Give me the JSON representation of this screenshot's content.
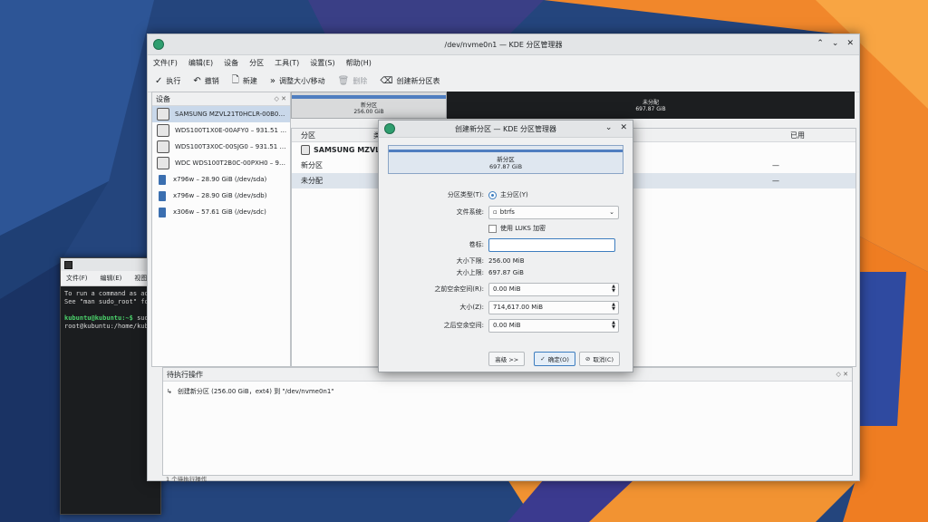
{
  "window": {
    "title": "/dev/nvme0n1 — KDE 分区管理器",
    "menu": [
      "文件(F)",
      "编辑(E)",
      "设备",
      "分区",
      "工具(T)",
      "设置(S)",
      "帮助(H)"
    ],
    "toolbar": {
      "apply": "执行",
      "undo": "撤销",
      "new": "新建",
      "resize": "调整大小/移动",
      "delete": "删除",
      "new_table": "创建新分区表"
    }
  },
  "devices": {
    "header": "设备",
    "items": [
      "SAMSUNG MZVL21T0HCLR-00B0…",
      "WDS100T1X0E-00AFY0 – 931.51 …",
      "WDS100T3X0C-00SJG0 – 931.51 …",
      "WDC WDS100T2B0C-00PXH0 – 9…",
      "x796w – 28.90 GiB (/dev/sda)",
      "x796w – 28.90 GiB (/dev/sdb)",
      "x306w – 57.61 GiB (/dev/sdc)"
    ]
  },
  "partition_map": {
    "new_label": "新分区",
    "new_size": "256.00 GiB",
    "unalloc_label": "未分配",
    "unalloc_size": "697.87 GiB"
  },
  "partition_table": {
    "col_partition": "分区",
    "col_type": "类型",
    "col_used": "已用",
    "device_name": "SAMSUNG MZVL21T0HCLR",
    "rows": [
      "新分区",
      "未分配"
    ],
    "used": [
      "—",
      "—"
    ]
  },
  "pending": {
    "header": "待执行操作",
    "item": "创建新分区 (256.00 GiB，ext4) 到 \"/dev/nvme0n1\"",
    "status": "1 个待执行操作"
  },
  "terminal": {
    "menu": [
      "文件(F)",
      "编辑(E)",
      "视图(V)"
    ],
    "line1": "To run a command as adm",
    "line2": "See \"man sudo_root\" for",
    "prompt1_user": "kubuntu@kubuntu:~$",
    "prompt1_cmd": " sudo",
    "prompt2": "root@kubuntu:/home/kubun"
  },
  "dialog": {
    "title": "创建新分区 — KDE 分区管理器",
    "preview_label": "新分区",
    "preview_size": "697.87 GiB",
    "type_label": "分区类型(T):",
    "type_value": "主分区(Y)",
    "fs_label": "文件系统:",
    "fs_value": "btrfs",
    "luks_label": "使用 LUKS 加密",
    "label_label": "卷标:",
    "min_label": "大小下限:",
    "min_value": "256.00 MiB",
    "max_label": "大小上限:",
    "max_value": "697.87 GiB",
    "free_before_label": "之前空余空间(R):",
    "free_before_value": "0.00 MiB",
    "size_label": "大小(Z):",
    "size_value": "714,617.00 MiB",
    "free_after_label": "之后空余空间:",
    "free_after_value": "0.00 MiB",
    "advanced": "高级 >>",
    "ok": "确定(O)",
    "cancel": "取消(C)"
  }
}
